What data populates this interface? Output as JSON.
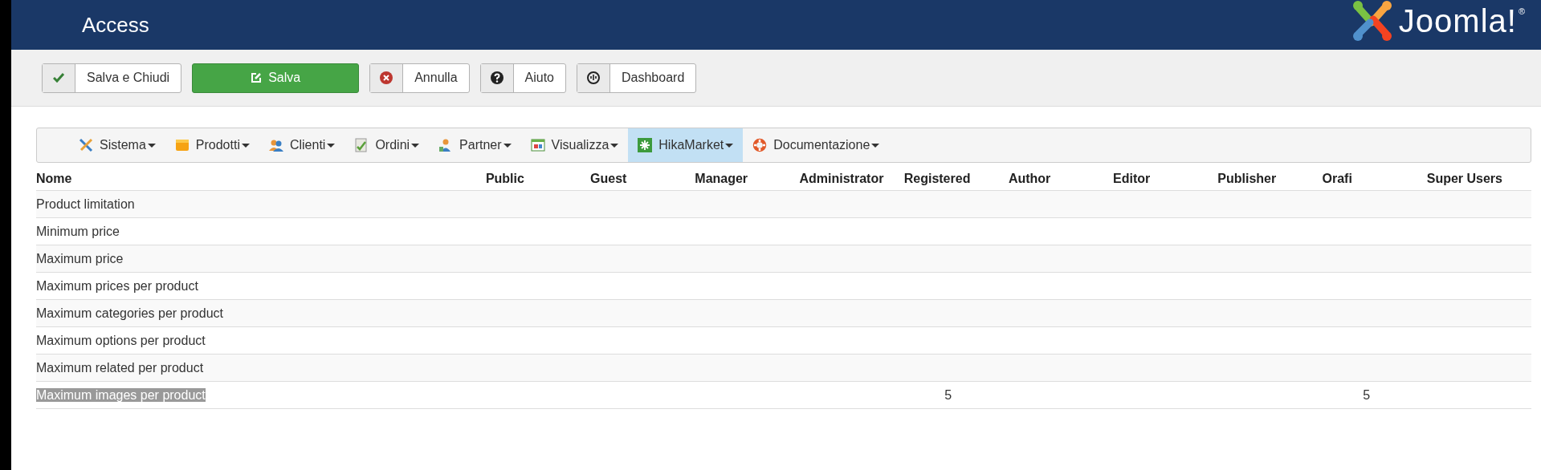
{
  "header": {
    "title": "Access",
    "logo": {
      "text": "Joomla!",
      "mark": "®"
    }
  },
  "toolbar": [
    {
      "label": "Salva e Chiudi",
      "kind": "check",
      "primary": false
    },
    {
      "label": "Salva",
      "kind": "edit",
      "primary": true
    },
    {
      "label": "Annulla",
      "kind": "cancel",
      "primary": false
    },
    {
      "label": "Aiuto",
      "kind": "help",
      "primary": false
    },
    {
      "label": "Dashboard",
      "kind": "dashboard",
      "primary": false
    }
  ],
  "menu": [
    {
      "label": "Sistema",
      "kind": "tools",
      "selected": false
    },
    {
      "label": "Prodotti",
      "kind": "box",
      "selected": false
    },
    {
      "label": "Clienti",
      "kind": "user",
      "selected": false
    },
    {
      "label": "Ordini",
      "kind": "document",
      "selected": false
    },
    {
      "label": "Partner",
      "kind": "partner",
      "selected": false
    },
    {
      "label": "Visualizza",
      "kind": "window",
      "selected": false
    },
    {
      "label": "HikaMarket",
      "kind": "market",
      "selected": true
    },
    {
      "label": "Documentazione",
      "kind": "lifebuoy",
      "selected": false
    }
  ],
  "table": {
    "columns": [
      "Nome",
      "Public",
      "Guest",
      "Manager",
      "Administrator",
      "Registered",
      "Author",
      "Editor",
      "Publisher",
      "Orafi",
      "Super Users"
    ],
    "rows": [
      {
        "name": "Product limitation",
        "selected": false
      },
      {
        "name": "Minimum price",
        "selected": false
      },
      {
        "name": "Maximum price",
        "selected": false
      },
      {
        "name": "Maximum prices per product",
        "selected": false
      },
      {
        "name": "Maximum categories per product",
        "selected": false
      },
      {
        "name": "Maximum options per product",
        "selected": false
      },
      {
        "name": "Maximum related per product",
        "selected": false
      },
      {
        "name": "Maximum images per product",
        "selected": true,
        "col_5": "5",
        "col_9": "5"
      }
    ]
  }
}
